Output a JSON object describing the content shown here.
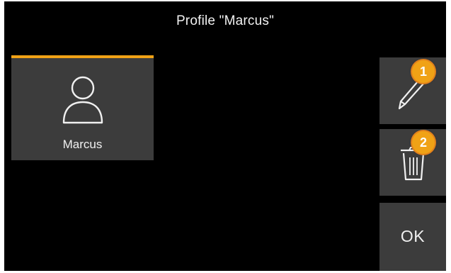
{
  "dialog": {
    "title": "Profile \"Marcus\""
  },
  "profiles": [
    {
      "name": "Marcus",
      "icon": "user-icon",
      "selected": true
    }
  ],
  "actions": {
    "edit": {
      "icon": "pencil-icon"
    },
    "delete": {
      "icon": "trash-icon"
    },
    "ok_label": "OK"
  },
  "markers": [
    {
      "label": "1"
    },
    {
      "label": "2"
    }
  ],
  "colors": {
    "background": "#000000",
    "tile": "#3c3c3c",
    "accent": "#f0a216",
    "text": "#f0f0f0",
    "marker_fill": "#f0a216",
    "marker_ring": "#e1801c"
  }
}
